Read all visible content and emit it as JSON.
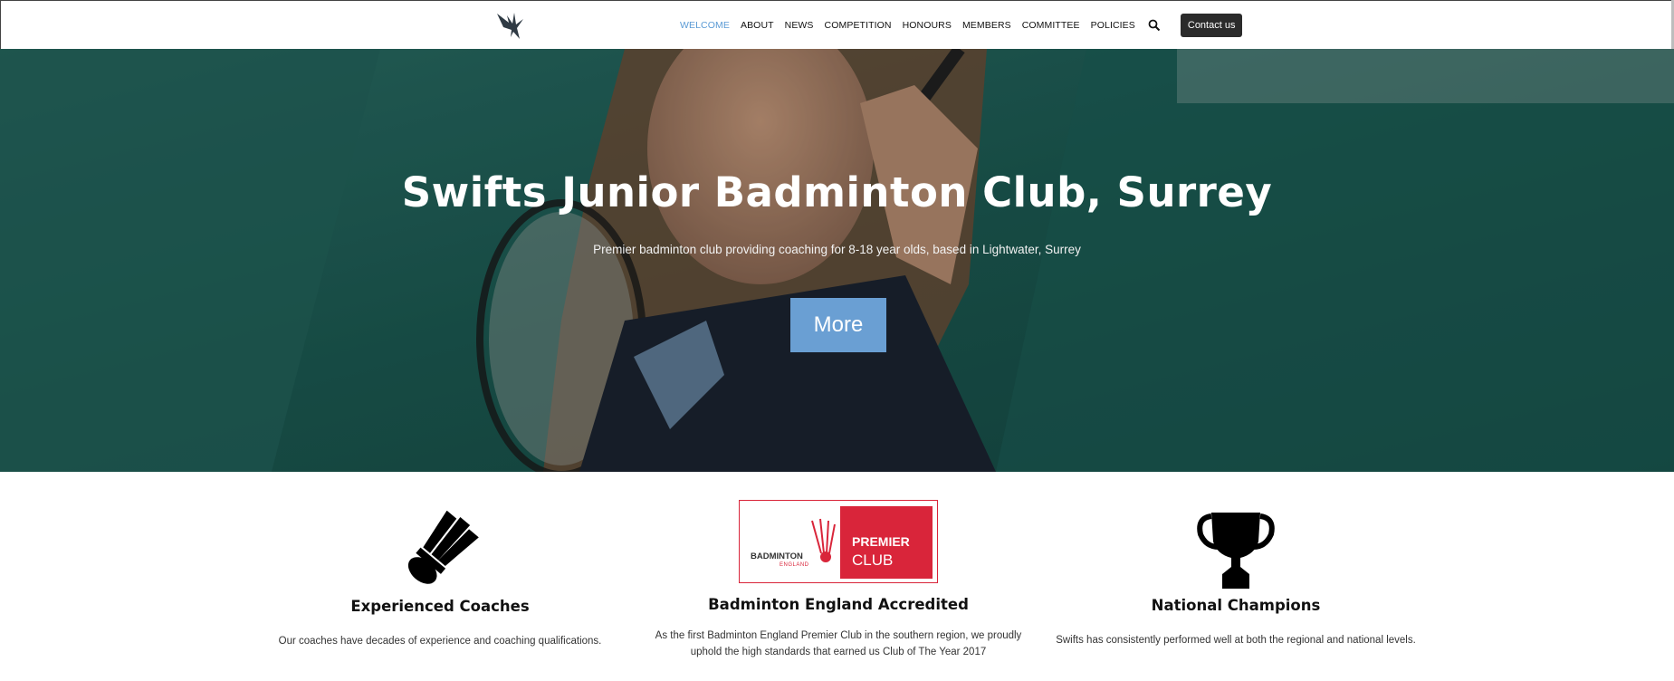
{
  "header": {
    "logo_icon": "swift-bird-icon",
    "nav": [
      {
        "label": "WELCOME",
        "active": true
      },
      {
        "label": "ABOUT"
      },
      {
        "label": "NEWS"
      },
      {
        "label": "COMPETITION"
      },
      {
        "label": "HONOURS"
      },
      {
        "label": "MEMBERS"
      },
      {
        "label": "COMMITTEE"
      },
      {
        "label": "POLICIES"
      }
    ],
    "search_icon": "search-icon",
    "contact_label": "Contact us"
  },
  "hero": {
    "title": "Swifts Junior Badminton Club, Surrey",
    "subtitle": "Premier badminton club providing coaching for 8-18 year olds, based in Lightwater, Surrey",
    "button_label": "More"
  },
  "features": [
    {
      "icon": "shuttlecock-icon",
      "title": "Experienced Coaches",
      "text": "Our coaches have decades of experience and coaching qualifications."
    },
    {
      "icon": "badminton-england-premier-club-logo",
      "logo_left_text": "BADMINTON",
      "logo_left_sub": "ENGLAND",
      "logo_right_line1": "PREMIER",
      "logo_right_line2": "CLUB",
      "title": "Badminton England Accredited",
      "text_line1": "As the first Badminton England Premier Club in the southern region, we proudly",
      "text_line2": "uphold the high standards that earned us Club of The Year 2017"
    },
    {
      "icon": "trophy-icon",
      "title": "National Champions",
      "text": "Swifts has consistently performed well at both the regional and national levels."
    }
  ],
  "colors": {
    "accent": "#5b9bd5",
    "button": "#6a9fd3",
    "contact_bg": "#2b2b2b",
    "premier_red": "#d9253a"
  }
}
